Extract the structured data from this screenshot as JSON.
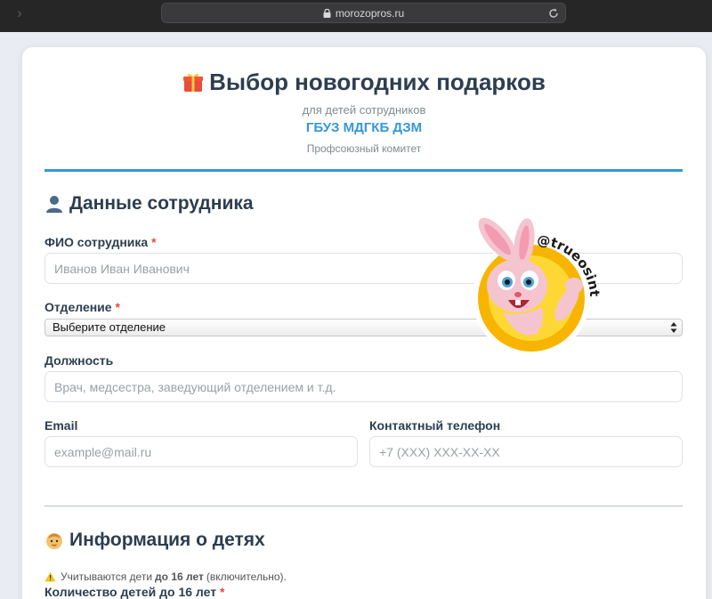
{
  "browser": {
    "url": "morozopros.ru"
  },
  "header": {
    "title": "Выбор новогодних подарков",
    "subtitle": "для детей сотрудников",
    "org_name": "ГБУЗ МДГКБ ДЗМ",
    "org_sub": "Профсоюзный комитет"
  },
  "employee_section": {
    "title": "Данные сотрудника",
    "fio": {
      "label": "ФИО сотрудника",
      "required_mark": "*",
      "placeholder": "Иванов Иван Иванович",
      "value": ""
    },
    "department": {
      "label": "Отделение",
      "required_mark": "*",
      "selected": "Выберите отделение"
    },
    "position": {
      "label": "Должность",
      "placeholder": "Врач, медсестра, заведующий отделением и т.д.",
      "value": ""
    },
    "email": {
      "label": "Email",
      "placeholder": "example@mail.ru",
      "value": ""
    },
    "phone": {
      "label": "Контактный телефон",
      "placeholder": "+7 (XXX) XXX-XX-XX",
      "value": ""
    }
  },
  "children_section": {
    "title": "Информация о детях",
    "note_prefix": "Учитываются дети",
    "note_bold": "до 16 лет",
    "note_suffix": "(включительно).",
    "count_label": "Количество детей до 16 лет",
    "required_mark": "*"
  },
  "sticker": {
    "handle": "@trueosint"
  },
  "colors": {
    "accent": "#3498db",
    "heading": "#2c3e50",
    "required": "#e74c3c",
    "muted": "#7f8c8d"
  },
  "icons": {
    "title": "gift-icon",
    "employee": "person-icon",
    "children": "baby-face-icon",
    "note": "warning-icon"
  }
}
